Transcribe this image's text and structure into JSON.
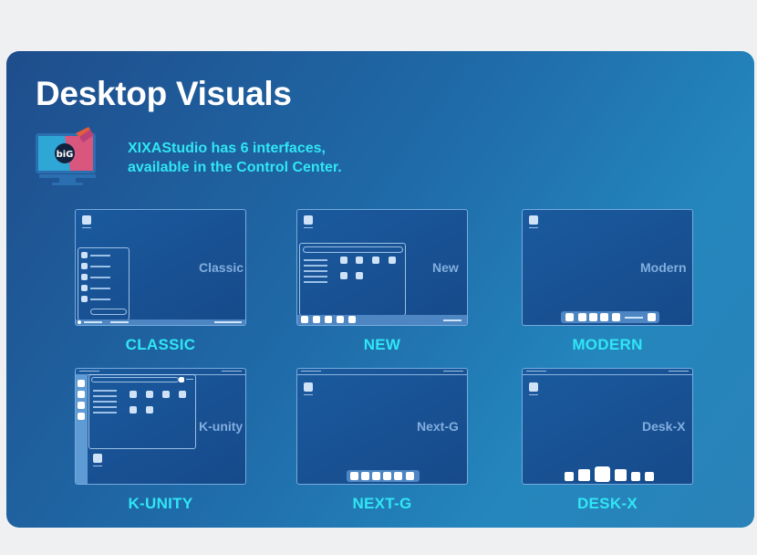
{
  "header": {
    "title": "Desktop Visuals",
    "subtitle_line1": "XIXAStudio has 6 interfaces,",
    "subtitle_line2": "available in the Control Center.",
    "monitor_icon": "monitor-logo-icon",
    "monitor_logo_text": "biG"
  },
  "colors": {
    "card_gradient_start": "#1f4d8c",
    "card_gradient_end": "#2a82b8",
    "accent": "#30e6f4",
    "title": "#ffffff",
    "page_bg": "#eef0f2"
  },
  "interfaces": [
    {
      "id": "classic",
      "preview_label": "Classic",
      "caption": "CLASSIC"
    },
    {
      "id": "new",
      "preview_label": "New",
      "caption": "NEW"
    },
    {
      "id": "modern",
      "preview_label": "Modern",
      "caption": "MODERN"
    },
    {
      "id": "k-unity",
      "preview_label": "K-unity",
      "caption": "K-UNITY"
    },
    {
      "id": "next-g",
      "preview_label": "Next-G",
      "caption": "NEXT-G"
    },
    {
      "id": "desk-x",
      "preview_label": "Desk-X",
      "caption": "DESK-X"
    }
  ]
}
